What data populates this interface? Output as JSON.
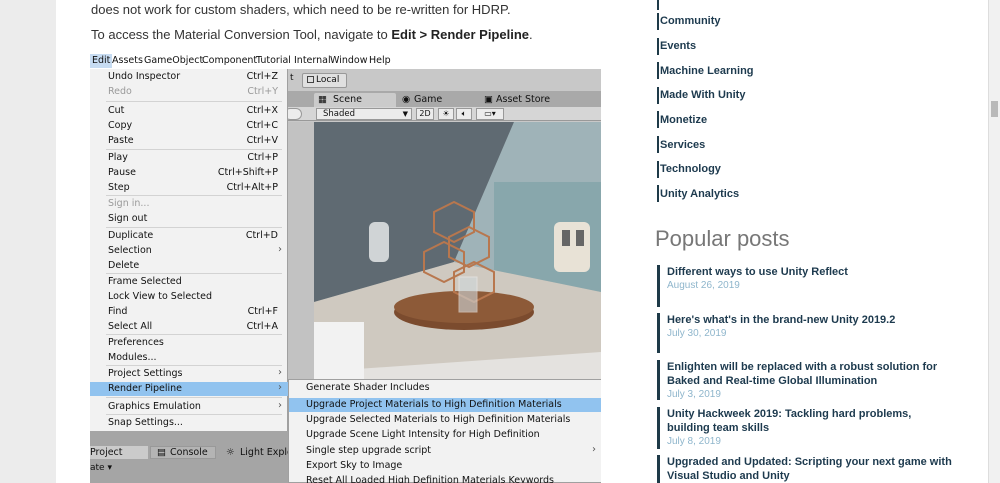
{
  "article": {
    "para1": "does not work for custom shaders, which need to be re-written for HDRP.",
    "para2_prefix": "To access the Material Conversion Tool, navigate to ",
    "para2_bold": "Edit > Render Pipeline",
    "para2_suffix": "."
  },
  "unity": {
    "menubar": [
      "Edit",
      "Assets",
      "GameObject",
      "Component",
      "Tutorial",
      "Internal",
      "Window",
      "Help"
    ],
    "toolbar": {
      "local": "Local",
      "t_frag": "t"
    },
    "tabs": {
      "scene": "Scene",
      "game": "Game",
      "asset_store": "Asset Store"
    },
    "scenebar": {
      "shaded": "Shaded",
      "mode_2d": "2D"
    },
    "edit_menu": [
      {
        "label": "Undo Inspector",
        "shortcut": "Ctrl+Z"
      },
      {
        "label": "Redo",
        "shortcut": "Ctrl+Y",
        "disabled": true
      },
      {
        "label": "Cut",
        "shortcut": "Ctrl+X"
      },
      {
        "label": "Copy",
        "shortcut": "Ctrl+C"
      },
      {
        "label": "Paste",
        "shortcut": "Ctrl+V"
      },
      {
        "label": "Play",
        "shortcut": "Ctrl+P"
      },
      {
        "label": "Pause",
        "shortcut": "Ctrl+Shift+P"
      },
      {
        "label": "Step",
        "shortcut": "Ctrl+Alt+P"
      },
      {
        "label": "Sign in...",
        "shortcut": "",
        "disabled": true
      },
      {
        "label": "Sign out",
        "shortcut": ""
      },
      {
        "label": "Duplicate",
        "shortcut": "Ctrl+D"
      },
      {
        "label": "Selection",
        "shortcut": "",
        "submenu": true
      },
      {
        "label": "Delete",
        "shortcut": ""
      },
      {
        "label": "Frame Selected",
        "shortcut": ""
      },
      {
        "label": "Lock View to Selected",
        "shortcut": ""
      },
      {
        "label": "Find",
        "shortcut": "Ctrl+F"
      },
      {
        "label": "Select All",
        "shortcut": "Ctrl+A"
      },
      {
        "label": "Preferences",
        "shortcut": ""
      },
      {
        "label": "Modules...",
        "shortcut": ""
      },
      {
        "label": "Project Settings",
        "shortcut": "",
        "submenu": true
      },
      {
        "label": "Render Pipeline",
        "shortcut": "",
        "submenu": true,
        "highlighted": true
      },
      {
        "label": "Graphics Emulation",
        "shortcut": "",
        "submenu": true
      },
      {
        "label": "Snap Settings...",
        "shortcut": ""
      }
    ],
    "render_pipeline_submenu": [
      {
        "label": "Generate Shader Includes"
      },
      {
        "label": "Upgrade Project Materials to High Definition Materials",
        "highlighted": true
      },
      {
        "label": "Upgrade Selected Materials to High Definition Materials"
      },
      {
        "label": "Upgrade Scene Light Intensity for High Definition"
      },
      {
        "label": "Single step upgrade script",
        "submenu": true
      },
      {
        "label": "Export Sky to Image"
      },
      {
        "label": "Reset All Loaded High Definition Materials Keywords"
      }
    ],
    "bottom_tabs": {
      "project": "Project",
      "console": "Console",
      "light_explorer": "Light Explo"
    },
    "bottom_frag": "ate ▾"
  },
  "sidebar": {
    "categories": [
      "Community",
      "Events",
      "Machine Learning",
      "Made With Unity",
      "Monetize",
      "Services",
      "Technology",
      "Unity Analytics"
    ],
    "popular_title": "Popular posts",
    "posts": [
      {
        "title": "Different ways to use Unity Reflect",
        "date": "August 26, 2019"
      },
      {
        "title": "Here's what's in the brand-new Unity 2019.2",
        "date": "July 30, 2019"
      },
      {
        "title": "Enlighten will be replaced with a robust solution for Baked and Real-time Global Illumination",
        "date": "July 3, 2019"
      },
      {
        "title": "Unity Hackweek 2019: Tackling hard problems, building team skills",
        "date": "July 8, 2019"
      },
      {
        "title": "Upgraded and Updated: Scripting your next game with Visual Studio and Unity",
        "date": ""
      }
    ]
  },
  "colors": {
    "accent": "#1e3a48",
    "menu_highlight": "#91c3ef",
    "post_date": "#8fb6cc"
  }
}
